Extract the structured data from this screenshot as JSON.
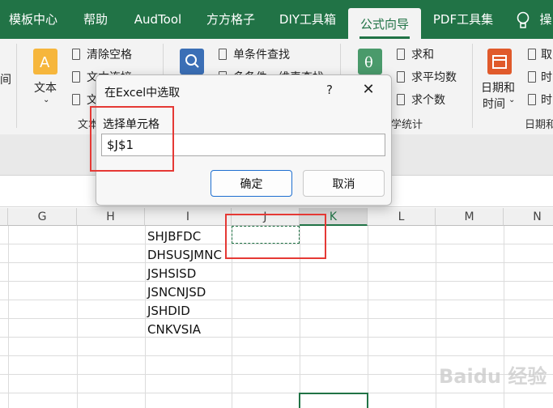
{
  "tabs": [
    {
      "label": "模板中心",
      "active": false
    },
    {
      "label": "帮助",
      "active": false
    },
    {
      "label": "AudTool",
      "active": false
    },
    {
      "label": "方方格子",
      "active": false
    },
    {
      "label": "DIY工具箱",
      "active": false
    },
    {
      "label": "公式向导",
      "active": true
    },
    {
      "label": "PDF工具集",
      "active": false
    }
  ],
  "tab_help_icon": "lightbulb-icon",
  "tab_overflow": "操",
  "ribbon": {
    "left_stub": "间",
    "text_big_label": "文本",
    "text_group_label": "文本",
    "text_items": [
      "清除空格",
      "文本连接",
      "文"
    ],
    "search_items": [
      "单条件查找",
      "多条件一维表查找"
    ],
    "math_items": [
      "求和",
      "求平均数",
      "求个数"
    ],
    "math_group_label": "数学统计",
    "math_group_prefix": "数",
    "date_big_label_1": "日期和",
    "date_big_label_2": "时间",
    "date_items": [
      "取",
      "时",
      "时"
    ],
    "date_group_label": "日期和"
  },
  "grid": {
    "columns": [
      "G",
      "H",
      "I",
      "J",
      "K",
      "L",
      "M",
      "N"
    ],
    "selected_column": "K",
    "column_i_values": [
      "SHJBFDC",
      "DHSUSJMNC",
      "JSHSISD",
      "JSNCNJSD",
      "JSHDID",
      "CNKVSIA"
    ]
  },
  "dialog": {
    "title": "在Excel中选取",
    "help": "?",
    "close": "✕",
    "label": "选择单元格",
    "input_value": "$J$1",
    "ok_label": "确定",
    "cancel_label": "取消"
  },
  "watermark": "Baidu 经验",
  "colors": {
    "excel_green": "#217346",
    "annotation_red": "#e53935",
    "primary_blue": "#1e6fd0"
  }
}
